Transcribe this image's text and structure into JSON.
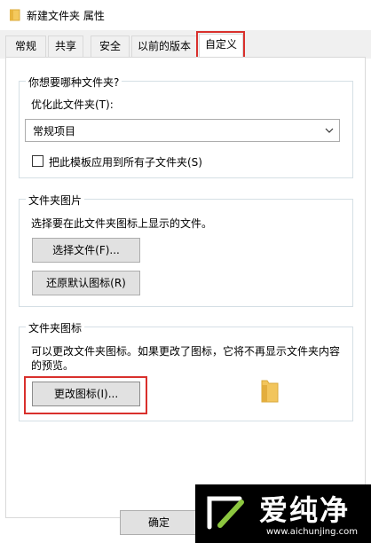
{
  "window": {
    "title": "新建文件夹 属性"
  },
  "tabs": [
    {
      "label": "常规"
    },
    {
      "label": "共享"
    },
    {
      "label": "安全"
    },
    {
      "label": "以前的版本"
    },
    {
      "label": "自定义"
    }
  ],
  "optimize_group": {
    "title": "你想要哪种文件夹?",
    "optimize_label": "优化此文件夹(T):",
    "selected": "常规项目",
    "checkbox_label": "把此模板应用到所有子文件夹(S)",
    "checkbox_checked": false
  },
  "picture_group": {
    "title": "文件夹图片",
    "description": "选择要在此文件夹图标上显示的文件。",
    "choose_file_label": "选择文件(F)...",
    "restore_default_label": "还原默认图标(R)"
  },
  "icon_group": {
    "title": "文件夹图标",
    "description_line1": "可以更改文件夹图标。如果更改了图标，它将不再显示文件夹内容",
    "description_line2": "的预览。",
    "change_icon_label": "更改图标(I)..."
  },
  "footer": {
    "ok_label": "确定"
  },
  "watermark": {
    "text": "爱纯净",
    "url": "www.aichunjing.com"
  },
  "colors": {
    "highlight": "#d9302c",
    "folder": "#f2c55c"
  }
}
